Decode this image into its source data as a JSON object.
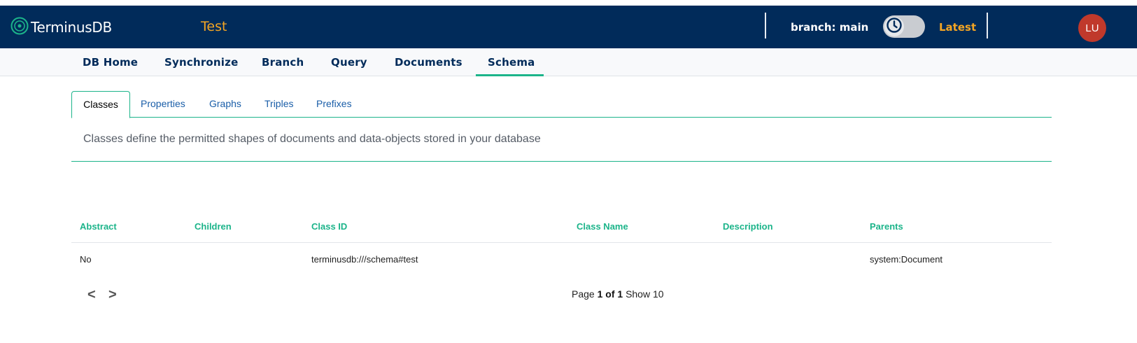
{
  "header": {
    "logo_text": "TerminusDB",
    "db_title": "Test",
    "branch_label": "branch: main",
    "latest_label": "Latest",
    "avatar_initials": "LU",
    "brand_color": "#012b5a",
    "accent_color": "#f5a623"
  },
  "subnav": {
    "items": [
      {
        "label": "DB Home"
      },
      {
        "label": "Synchronize"
      },
      {
        "label": "Branch"
      },
      {
        "label": "Query"
      },
      {
        "label": "Documents"
      },
      {
        "label": "Schema"
      }
    ],
    "active": "Schema",
    "active_color": "#1cb48a"
  },
  "tabs": {
    "items": [
      {
        "label": "Classes"
      },
      {
        "label": "Properties"
      },
      {
        "label": "Graphs"
      },
      {
        "label": "Triples"
      },
      {
        "label": "Prefixes"
      }
    ],
    "active": "Classes"
  },
  "description": "Classes define the permitted shapes of documents and data-objects stored in your database",
  "table": {
    "columns": [
      "Abstract",
      "Children",
      "Class ID",
      "Class Name",
      "Description",
      "Parents"
    ],
    "rows": [
      {
        "abstract": "No",
        "children": "",
        "class_id": "terminusdb:///schema#test",
        "class_name": "",
        "description": "",
        "parents": "system:Document"
      }
    ]
  },
  "pagination": {
    "prev_label": "<",
    "next_label": ">",
    "page_word": "Page",
    "page_current_of_total": "1 of 1",
    "show_label": "Show 10"
  }
}
